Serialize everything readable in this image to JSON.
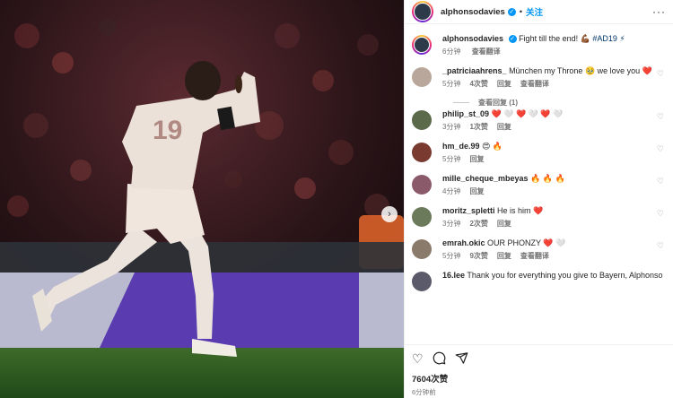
{
  "post": {
    "username": "alphonsodavies",
    "follow_label": "关注",
    "caption": "Fight till the end! 💪🏾",
    "hashtag": "#AD19 ⚡",
    "caption_time": "6分钟",
    "see_translation": "查看翻译",
    "likes": "7604次赞",
    "posted": "6分钟前",
    "jersey_number": "19"
  },
  "comments": [
    {
      "user": "_patriciaahrens_",
      "text": "München my Throne 🥹 we love you ❤️",
      "time": "5分钟",
      "likes": "4次赞",
      "reply": "回复",
      "translate": "查看翻译",
      "avatar_color": "#b8a79a",
      "replies_label": "查看回复 (1)"
    },
    {
      "user": "philip_st_09",
      "text": "❤️ 🤍 ❤️ 🤍 ❤️ 🤍",
      "time": "3分钟",
      "likes": "1次赞",
      "reply": "回复",
      "translate": "",
      "avatar_color": "#5a6a4a",
      "replies_label": ""
    },
    {
      "user": "hm_de.99",
      "text": "😍 🔥",
      "time": "5分钟",
      "likes": "",
      "reply": "回复",
      "translate": "",
      "avatar_color": "#7a3a30",
      "replies_label": ""
    },
    {
      "user": "mille_cheque_mbeyas",
      "text": "🔥 🔥 🔥",
      "time": "4分钟",
      "likes": "",
      "reply": "回复",
      "translate": "",
      "avatar_color": "#8a5a6a",
      "replies_label": ""
    },
    {
      "user": "moritz_spletti",
      "text": "He is him ❤️",
      "time": "3分钟",
      "likes": "2次赞",
      "reply": "回复",
      "translate": "",
      "avatar_color": "#6a7a5a",
      "replies_label": ""
    },
    {
      "user": "emrah.okic",
      "text": "OUR PHONZY ❤️ 🤍",
      "time": "5分钟",
      "likes": "9次赞",
      "reply": "回复",
      "translate": "查看翻译",
      "avatar_color": "#8a7a6a",
      "replies_label": ""
    },
    {
      "user": "16.lee",
      "text": "Thank you for everything you give to Bayern, Alphonso",
      "time": "",
      "likes": "",
      "reply": "",
      "translate": "",
      "avatar_color": "#5a5a6a",
      "replies_label": ""
    }
  ],
  "icons": {
    "heart": "heart-icon",
    "comment": "comment-icon",
    "share": "share-icon",
    "more": "more-icon",
    "next": "chevron-right-icon"
  },
  "colors": {
    "accent": "#0095f6",
    "heart_red": "#ed4956"
  }
}
